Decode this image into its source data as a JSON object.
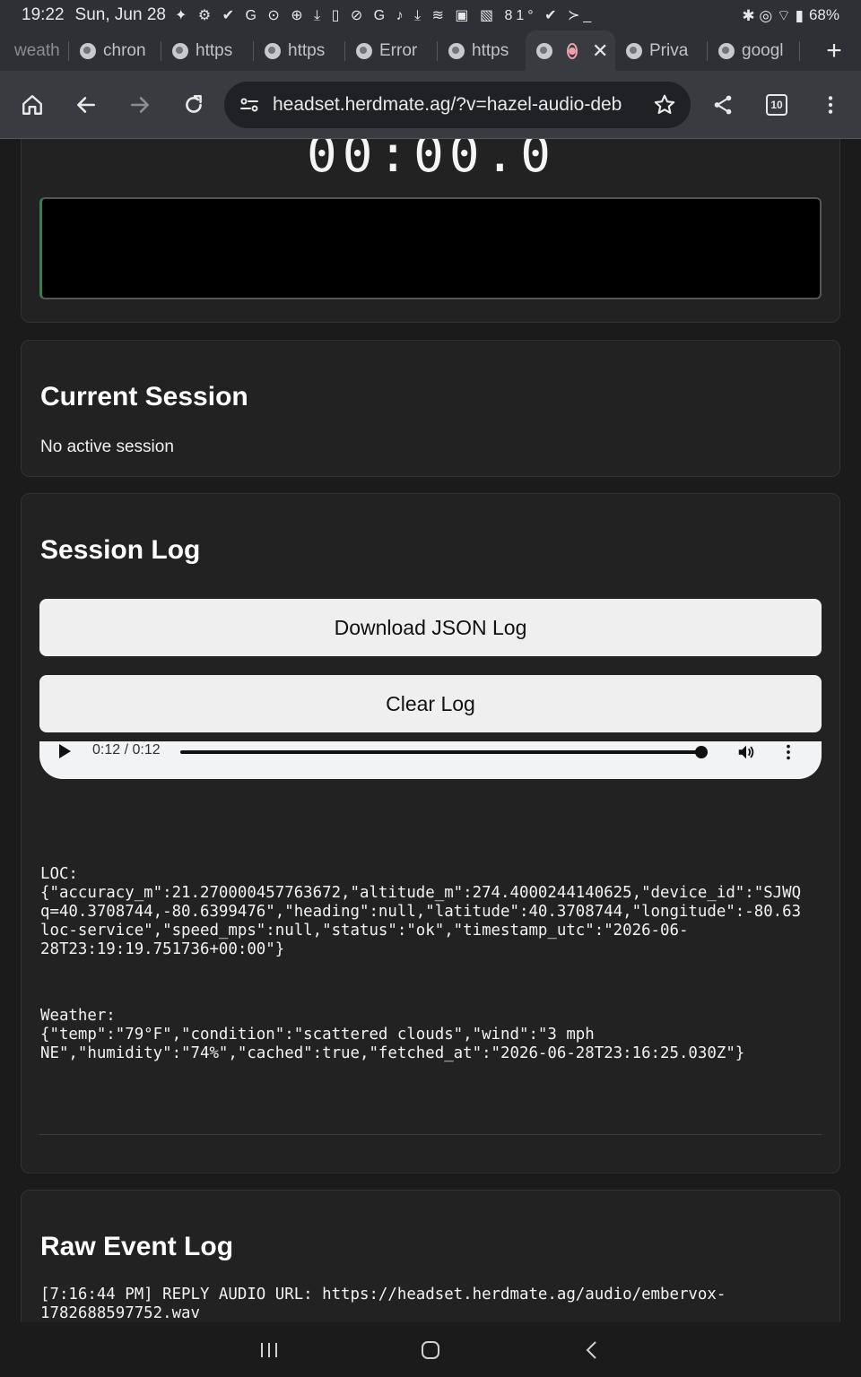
{
  "status_bar": {
    "time": "19:22",
    "date": "Sun, Jun 28",
    "notifications": "✦ ⚙ ✔ G ⊙ ⊕ ⤓ ▯ ⊘ G ♪ ⤓ ≋ ▣ ▧ 81° ✔ ≻_",
    "right_icons": "✱ ◎ ⌔ ▮",
    "battery": "68%"
  },
  "tabs": [
    {
      "label": "weath",
      "active": false
    },
    {
      "label": "chron",
      "active": false
    },
    {
      "label": "https",
      "active": false
    },
    {
      "label": "https",
      "active": false
    },
    {
      "label": "Error",
      "active": false
    },
    {
      "label": "https",
      "active": false
    },
    {
      "label": "",
      "active": true
    },
    {
      "label": "Priva",
      "active": false
    },
    {
      "label": "googl",
      "active": false
    }
  ],
  "toolbar": {
    "url": "headset.herdmate.ag/?v=hazel-audio-debug",
    "tab_count": "10"
  },
  "recorder": {
    "timer": "00:00.0"
  },
  "current_session": {
    "title": "Current Session",
    "status": "No active session"
  },
  "session_log": {
    "title": "Session Log",
    "download_label": "Download JSON Log",
    "clear_label": "Clear Log",
    "player_time": "0:12 / 0:12",
    "player_progress": 1.0,
    "loc_label": "LOC:",
    "loc_lines": [
      "{\"accuracy_m\":21.270000457763672,\"altitude_m\":274.4000244140625,\"device_id\":\"SJWQ",
      "q=40.3708744,-80.6399476\",\"heading\":null,\"latitude\":40.3708744,\"longitude\":-80.63",
      "loc-service\",\"speed_mps\":null,\"status\":\"ok\",\"timestamp_utc\":\"2026-06-",
      "28T23:19:19.751736+00:00\"}"
    ],
    "weather_label": "Weather:",
    "weather_lines": [
      "{\"temp\":\"79°F\",\"condition\":\"scattered clouds\",\"wind\":\"3 mph",
      "NE\",\"humidity\":\"74%\",\"cached\":true,\"fetched_at\":\"2026-06-28T23:16:25.030Z\"}"
    ]
  },
  "raw_event_log": {
    "title": "Raw Event Log",
    "lines": [
      "[7:16:44 PM] REPLY AUDIO URL: https://headset.herdmate.ag/audio/embervox-",
      "1782688597752.wav"
    ]
  },
  "colors": {
    "background": "#1b1b1b",
    "card": "#222222",
    "chrome_bar": "#3a3b41",
    "tab_strip": "#2f3036",
    "button": "#efefef"
  }
}
